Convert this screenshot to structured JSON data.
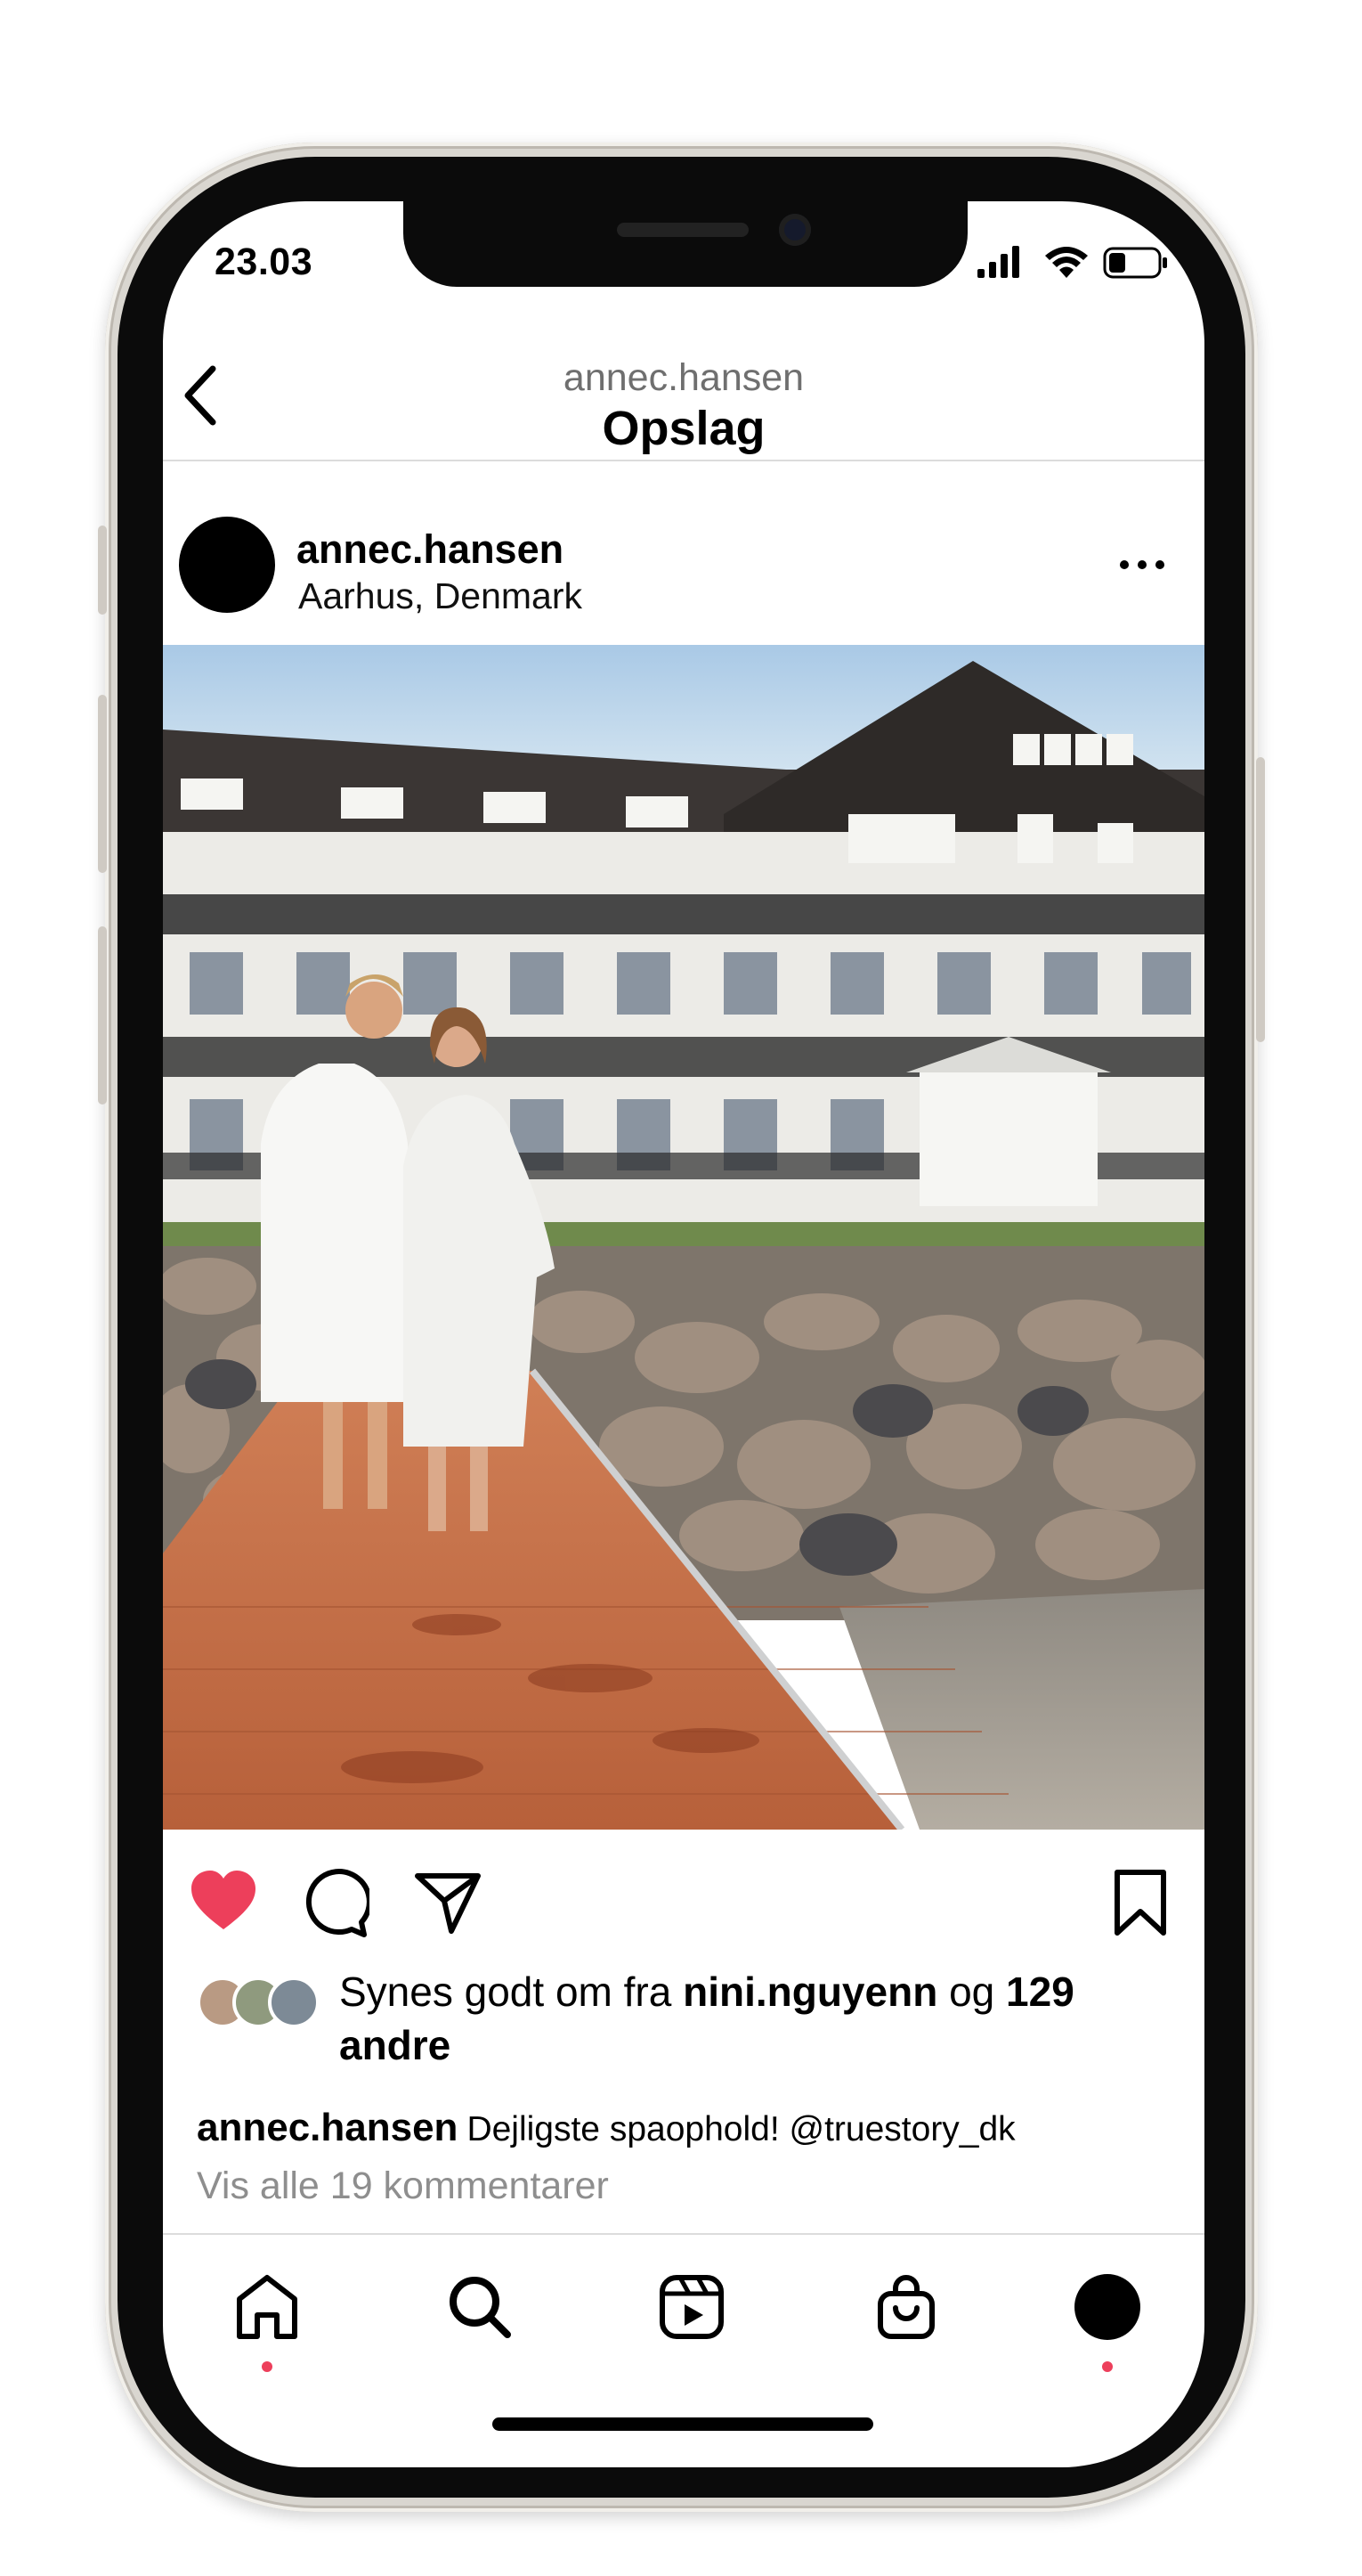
{
  "status_bar": {
    "time": "23.03"
  },
  "header": {
    "username": "annec.hansen",
    "title": "Opslag"
  },
  "post": {
    "username": "annec.hansen",
    "location": "Aarhus, Denmark",
    "liked": true,
    "likes": {
      "prefix": "Synes godt om fra",
      "user": "nini.nguyenn",
      "connector": "og",
      "count_text": "129 andre"
    },
    "caption": {
      "username": "annec.hansen",
      "text": "Dejligste spaophold! @truestory_dk"
    },
    "comments_link": "Vis alle 19 kommentarer"
  },
  "icons": {
    "back": "chevron-left-icon",
    "more": "more-horizontal-icon",
    "like": "heart-icon",
    "comment": "comment-icon",
    "share": "paper-plane-icon",
    "save": "bookmark-icon",
    "nav": [
      "home-icon",
      "search-icon",
      "reels-icon",
      "shop-icon",
      "profile-icon"
    ]
  },
  "colors": {
    "like": "#ed3f5b",
    "text": "#000000",
    "muted": "#8e8e8e"
  }
}
